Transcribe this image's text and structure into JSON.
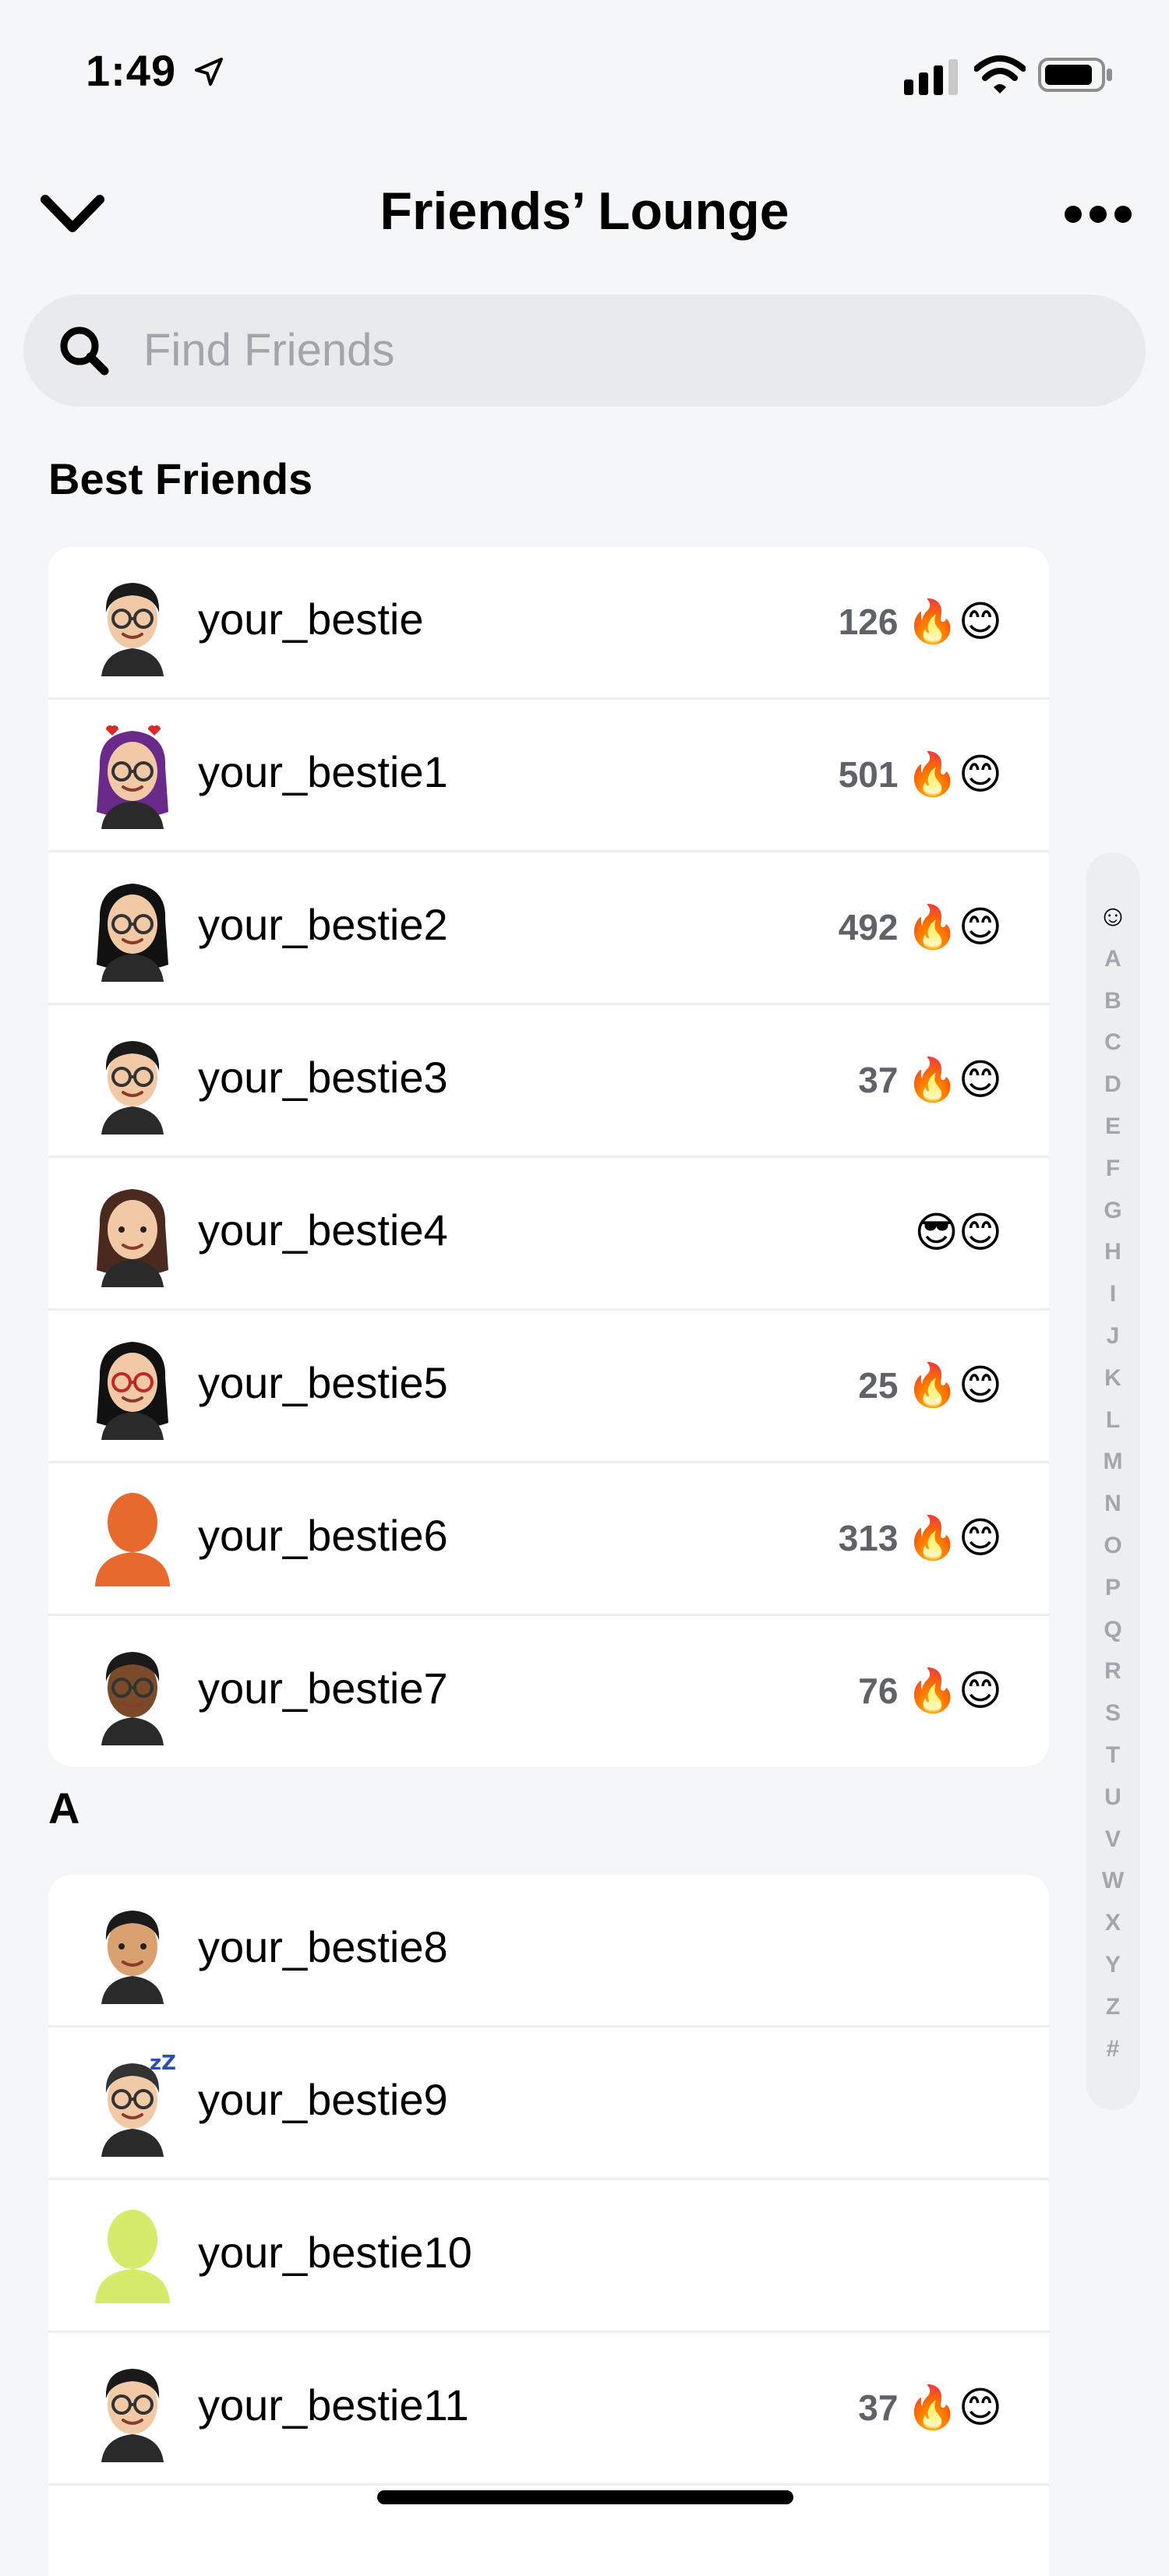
{
  "status_bar": {
    "time": "1:49"
  },
  "header": {
    "title": "Friends’ Lounge"
  },
  "search": {
    "placeholder": "Find Friends"
  },
  "sections": [
    {
      "title": "Best Friends",
      "rows": [
        {
          "name": "your_bestie",
          "count": "126",
          "emojis": "🔥😊",
          "avatar": "glasses-man-avatar"
        },
        {
          "name": "your_bestie1",
          "count": "501",
          "emojis": "🔥😊",
          "avatar": "purple-hair-hearts-avatar"
        },
        {
          "name": "your_bestie2",
          "count": "492",
          "emojis": "🔥😊",
          "avatar": "black-hair-glasses-woman-avatar"
        },
        {
          "name": "your_bestie3",
          "count": "37",
          "emojis": "🔥😊",
          "avatar": "round-glasses-man-avatar"
        },
        {
          "name": "your_bestie4",
          "count": "",
          "emojis": "😎😊",
          "avatar": "brown-hair-woman-avatar"
        },
        {
          "name": "your_bestie5",
          "count": "25",
          "emojis": "🔥😊",
          "avatar": "red-glasses-woman-avatar"
        },
        {
          "name": "your_bestie6",
          "count": "313",
          "emojis": "🔥😊",
          "avatar": "orange-silhouette-avatar"
        },
        {
          "name": "your_bestie7",
          "count": "76",
          "emojis": "🔥😊",
          "avatar": "dark-skin-glasses-man-avatar"
        }
      ]
    },
    {
      "title": "A",
      "rows": [
        {
          "name": "your_bestie8",
          "count": "",
          "emojis": "",
          "avatar": "suit-man-avatar"
        },
        {
          "name": "your_bestie9",
          "count": "",
          "emojis": "",
          "avatar": "sleepy-bun-avatar"
        },
        {
          "name": "your_bestie10",
          "count": "",
          "emojis": "",
          "avatar": "lime-silhouette-avatar"
        },
        {
          "name": "your_bestie11",
          "count": "37",
          "emojis": "🔥😊",
          "avatar": "round-glasses-man-avatar"
        },
        {
          "name": "",
          "count": "",
          "emojis": "💙",
          "avatar": "partial-avatar"
        }
      ]
    }
  ],
  "alphabet_index": [
    "☺",
    "A",
    "B",
    "C",
    "D",
    "E",
    "F",
    "G",
    "H",
    "I",
    "J",
    "K",
    "L",
    "M",
    "N",
    "O",
    "P",
    "Q",
    "R",
    "S",
    "T",
    "U",
    "V",
    "W",
    "X",
    "Y",
    "Z",
    "#"
  ],
  "colors": {
    "accent_orange": "#e8692d",
    "silhouette_lime": "#d6ea6b"
  }
}
